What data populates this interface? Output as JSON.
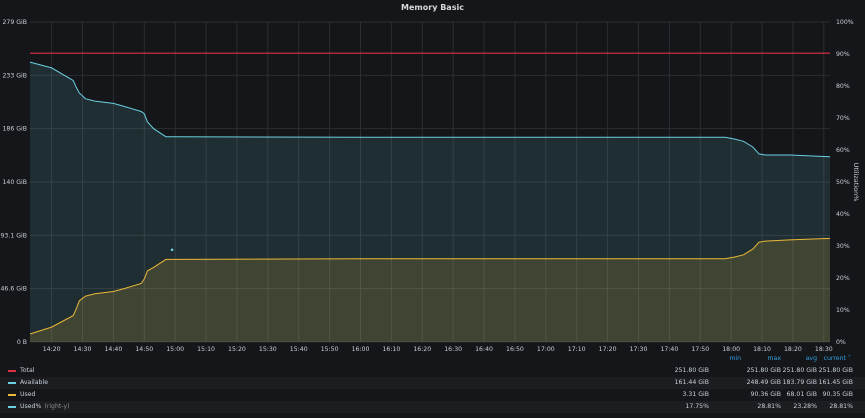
{
  "panel": {
    "title": "Memory Basic"
  },
  "chart_data": {
    "type": "line",
    "title": "Memory Basic",
    "ylabel_right": "Utilization%",
    "ylim_left": [
      0,
      279
    ],
    "ylim_right": [
      0,
      100
    ],
    "y_ticks_left": [
      "0 B",
      "46.6 GiB",
      "93.1 GiB",
      "140 GiB",
      "186 GiB",
      "233 GiB",
      "279 GiB"
    ],
    "y_ticks_right": [
      "0%",
      "10%",
      "20%",
      "30%",
      "40%",
      "50%",
      "60%",
      "70%",
      "80%",
      "90%",
      "100%"
    ],
    "x_ticks": [
      "14:20",
      "14:30",
      "14:40",
      "14:50",
      "15:00",
      "15:10",
      "15:20",
      "15:30",
      "15:40",
      "15:50",
      "16:00",
      "16:10",
      "16:20",
      "16:30",
      "16:40",
      "16:50",
      "17:00",
      "17:10",
      "17:20",
      "17:30",
      "17:40",
      "17:50",
      "18:00",
      "18:10",
      "18:20",
      "18:30"
    ],
    "grid": true,
    "threshold": {
      "value_percent": 90,
      "color": "#e02f44"
    },
    "series": [
      {
        "name": "Available",
        "color": "#6ccfe2",
        "fill": true,
        "points": [
          [
            "14:13",
            244
          ],
          [
            "14:20",
            239
          ],
          [
            "14:27",
            228
          ],
          [
            "14:28",
            222
          ],
          [
            "14:29",
            217
          ],
          [
            "14:31",
            212
          ],
          [
            "14:34",
            210
          ],
          [
            "14:40",
            208
          ],
          [
            "14:44",
            205
          ],
          [
            "14:49",
            201
          ],
          [
            "14:50",
            199
          ],
          [
            "14:51",
            192
          ],
          [
            "14:53",
            186
          ],
          [
            "14:57",
            179
          ],
          [
            "15:00",
            179
          ],
          [
            "16:00",
            178.5
          ],
          [
            "17:00",
            178.5
          ],
          [
            "17:58",
            178.5
          ],
          [
            "18:01",
            177
          ],
          [
            "18:04",
            175
          ],
          [
            "18:07",
            170
          ],
          [
            "18:09",
            164
          ],
          [
            "18:11",
            163
          ],
          [
            "18:19",
            163
          ],
          [
            "18:32",
            161.45
          ]
        ]
      },
      {
        "name": "Used",
        "color": "#eab839",
        "fill": true,
        "points": [
          [
            "14:13",
            7
          ],
          [
            "14:20",
            13
          ],
          [
            "14:27",
            23
          ],
          [
            "14:28",
            29
          ],
          [
            "14:29",
            36
          ],
          [
            "14:31",
            40
          ],
          [
            "14:34",
            42
          ],
          [
            "14:40",
            44
          ],
          [
            "14:44",
            47
          ],
          [
            "14:49",
            51
          ],
          [
            "14:50",
            55
          ],
          [
            "14:51",
            62
          ],
          [
            "14:53",
            65
          ],
          [
            "14:57",
            72
          ],
          [
            "15:00",
            72
          ],
          [
            "16:00",
            72.5
          ],
          [
            "17:00",
            72.5
          ],
          [
            "17:58",
            72.5
          ],
          [
            "18:01",
            74
          ],
          [
            "18:04",
            76
          ],
          [
            "18:07",
            81
          ],
          [
            "18:09",
            87
          ],
          [
            "18:11",
            88
          ],
          [
            "18:19",
            89
          ],
          [
            "18:32",
            90.35
          ]
        ]
      },
      {
        "name": "Used%",
        "axis": "right-y",
        "color": "#6ccfe2",
        "points": [
          [
            "14:59",
            28.81
          ]
        ]
      },
      {
        "name": "Total",
        "color": "#e02f44",
        "points": [
          [
            "14:13",
            251.8
          ],
          [
            "18:32",
            251.8
          ]
        ]
      }
    ]
  },
  "legend": {
    "headers": {
      "min": "min",
      "max": "max",
      "avg": "avg",
      "current": "current ˅"
    },
    "rows": [
      {
        "name": "Total",
        "sub": "",
        "color": "#e02f44",
        "min": "251.80 GiB",
        "max": "251.80 GiB",
        "avg": "251.80 GiB",
        "current": "251.80 GiB"
      },
      {
        "name": "Available",
        "sub": "",
        "color": "#6ccfe2",
        "min": "161.44 GiB",
        "max": "248.49 GiB",
        "avg": "183.79 GiB",
        "current": "161.45 GiB"
      },
      {
        "name": "Used",
        "sub": "",
        "color": "#eab839",
        "min": "3.31 GiB",
        "max": "90.36 GiB",
        "avg": "68.01 GiB",
        "current": "90.35 GiB"
      },
      {
        "name": "Used%",
        "sub": "(right-y)",
        "color": "#6ccfe2",
        "min": "17.75%",
        "max": "28.81%",
        "avg": "23.28%",
        "current": "28.81%"
      }
    ]
  }
}
